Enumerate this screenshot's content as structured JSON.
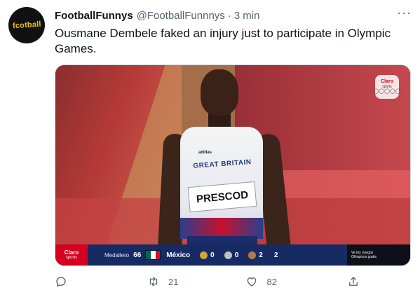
{
  "tweet": {
    "avatar_text": "fcotball",
    "display_name": "FootballFunnys",
    "handle": "@FootballFunnnys",
    "separator": "·",
    "time": "3 min",
    "more_label": "···",
    "text": "Ousmane Dembele faked an injury just to participate in Olympic Games."
  },
  "media": {
    "vest_brand": "adidas",
    "vest_team": "GREAT BRITAIN",
    "bib_name": "PRESCOD",
    "badge_brand": "Claro",
    "badge_sub": "sports",
    "badge_rings": "◯◯◯◯◯",
    "scorebar": {
      "brand_top": "Claro",
      "brand_bottom": "sports",
      "label": "Medallero",
      "rank": "66",
      "country": "México",
      "gold": "0",
      "silver": "0",
      "bronze": "2",
      "total": "2",
      "promo_line1": "Ve los Juegos",
      "promo_line2": "Olímpicos gratis"
    }
  },
  "actions": {
    "retweet_count": "21",
    "like_count": "82"
  },
  "colors": {
    "name": "#0f1419",
    "muted": "#536471",
    "gold": "#d4a537",
    "silver": "#c0c0c0",
    "bronze": "#b07a4a",
    "flag_green": "#006847",
    "flag_white": "#ffffff",
    "flag_red": "#ce1126"
  }
}
